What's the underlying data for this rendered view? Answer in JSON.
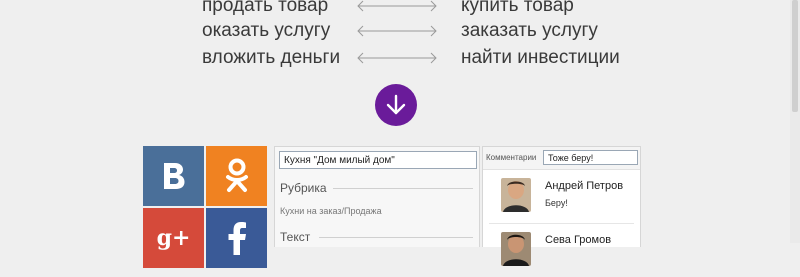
{
  "pairs": [
    {
      "left": "продать товар",
      "right": "купить товар"
    },
    {
      "left": "оказать услугу",
      "right": "заказать услугу"
    },
    {
      "left": "вложить деньги",
      "right": "найти инвестиции"
    }
  ],
  "social": {
    "vk": "vk-icon",
    "ok": "odnoklassniki-icon",
    "gp": "google-plus-icon",
    "fb": "facebook-icon",
    "gp_label": "g+"
  },
  "form": {
    "title_value": "Кухня \"Дом милый дом\"",
    "rubric_label": "Рубрика",
    "rubric_value": "Кухни на заказ/Продажа",
    "text_label": "Текст"
  },
  "comments": {
    "label": "Комментарии",
    "input_value": "Тоже беру!",
    "items": [
      {
        "name": "Андрей Петров",
        "text": "Беру!"
      },
      {
        "name": "Сева Громов",
        "text": ""
      }
    ]
  },
  "colors": {
    "accent": "#6a1b9a",
    "vk": "#4a6f99",
    "ok": "#f08221",
    "google_plus": "#d54a3a",
    "facebook": "#3a5a97"
  }
}
